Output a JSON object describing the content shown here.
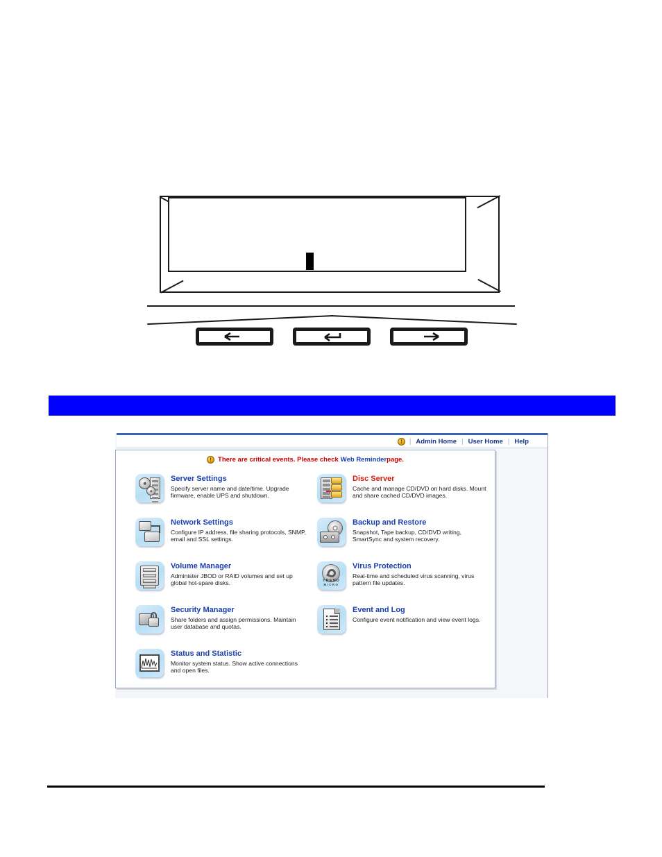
{
  "page": {
    "type": "manual-page",
    "bottom_rule": true
  },
  "lcd_panel": {
    "name": "LCD front panel",
    "cursor_visible": true,
    "buttons": [
      {
        "name": "left-arrow-button",
        "glyph": "<"
      },
      {
        "name": "enter-button",
        "glyph": "↵"
      },
      {
        "name": "right-arrow-button",
        "glyph": ">"
      }
    ]
  },
  "section_bar": {
    "color": "#0000ff",
    "label": ""
  },
  "web_ui": {
    "topnav": {
      "warning_icon": "warning-icon",
      "separator": "|",
      "links": [
        {
          "label": "Admin Home"
        },
        {
          "label": "User Home"
        },
        {
          "label": "Help"
        }
      ]
    },
    "critical_banner": {
      "icon": "warning-icon",
      "text_before": "There are critical events. Please check",
      "link_text": "Web Reminder",
      "text_after": "page.",
      "text_color": "#cc0000",
      "link_color": "#1a3fb0"
    },
    "menu": {
      "title_color": "#1a3fb0",
      "highlight_color": "#d61a0a",
      "items": [
        {
          "id": "server-settings",
          "icon": "server-gears-icon",
          "title": "Server Settings",
          "title_style": "normal",
          "desc": "Specify server name and date/time. Upgrade firmware, enable UPS and shutdown.",
          "column": "left"
        },
        {
          "id": "disc-server",
          "icon": "disc-server-icon",
          "title": "Disc Server",
          "title_style": "highlight",
          "desc": "Cache and manage CD/DVD on hard disks. Mount and share cached CD/DVD images.",
          "column": "right"
        },
        {
          "id": "network-settings",
          "icon": "network-computers-icon",
          "title": "Network Settings",
          "title_style": "normal",
          "desc": "Configure IP address, file sharing protocols, SNMP, email and SSL settings.",
          "column": "left"
        },
        {
          "id": "backup-and-restore",
          "icon": "tape-cd-icon",
          "title": "Backup and Restore",
          "title_style": "normal",
          "desc": "Snapshot, Tape backup, CD/DVD writing, SmartSync and system recovery.",
          "column": "right"
        },
        {
          "id": "volume-manager",
          "icon": "disk-stack-icon",
          "title": "Volume Manager",
          "title_style": "normal",
          "desc": "Administer JBOD or RAID volumes and set up global hot-spare disks.",
          "column": "left"
        },
        {
          "id": "virus-protection",
          "icon": "trend-micro-icon",
          "title": "Virus Protection",
          "title_style": "normal",
          "desc": "Real-time and scheduled virus scanning, virus pattern file updates.",
          "column": "right",
          "brand": {
            "line1": "TREND",
            "line2": "MICRO"
          }
        },
        {
          "id": "security-manager",
          "icon": "folder-padlock-icon",
          "title": "Security Manager",
          "title_style": "normal",
          "desc": "Share folders and assign permissions. Maintain user database and quotas.",
          "column": "left"
        },
        {
          "id": "event-and-log",
          "icon": "document-list-icon",
          "title": "Event and Log",
          "title_style": "normal",
          "desc": "Configure event notification and view event logs.",
          "column": "right"
        },
        {
          "id": "status-and-statistic",
          "icon": "chart-monitor-icon",
          "title": "Status and Statistic",
          "title_style": "normal",
          "desc": "Monitor system status. Show active connections and open files.",
          "column": "left"
        }
      ]
    }
  }
}
